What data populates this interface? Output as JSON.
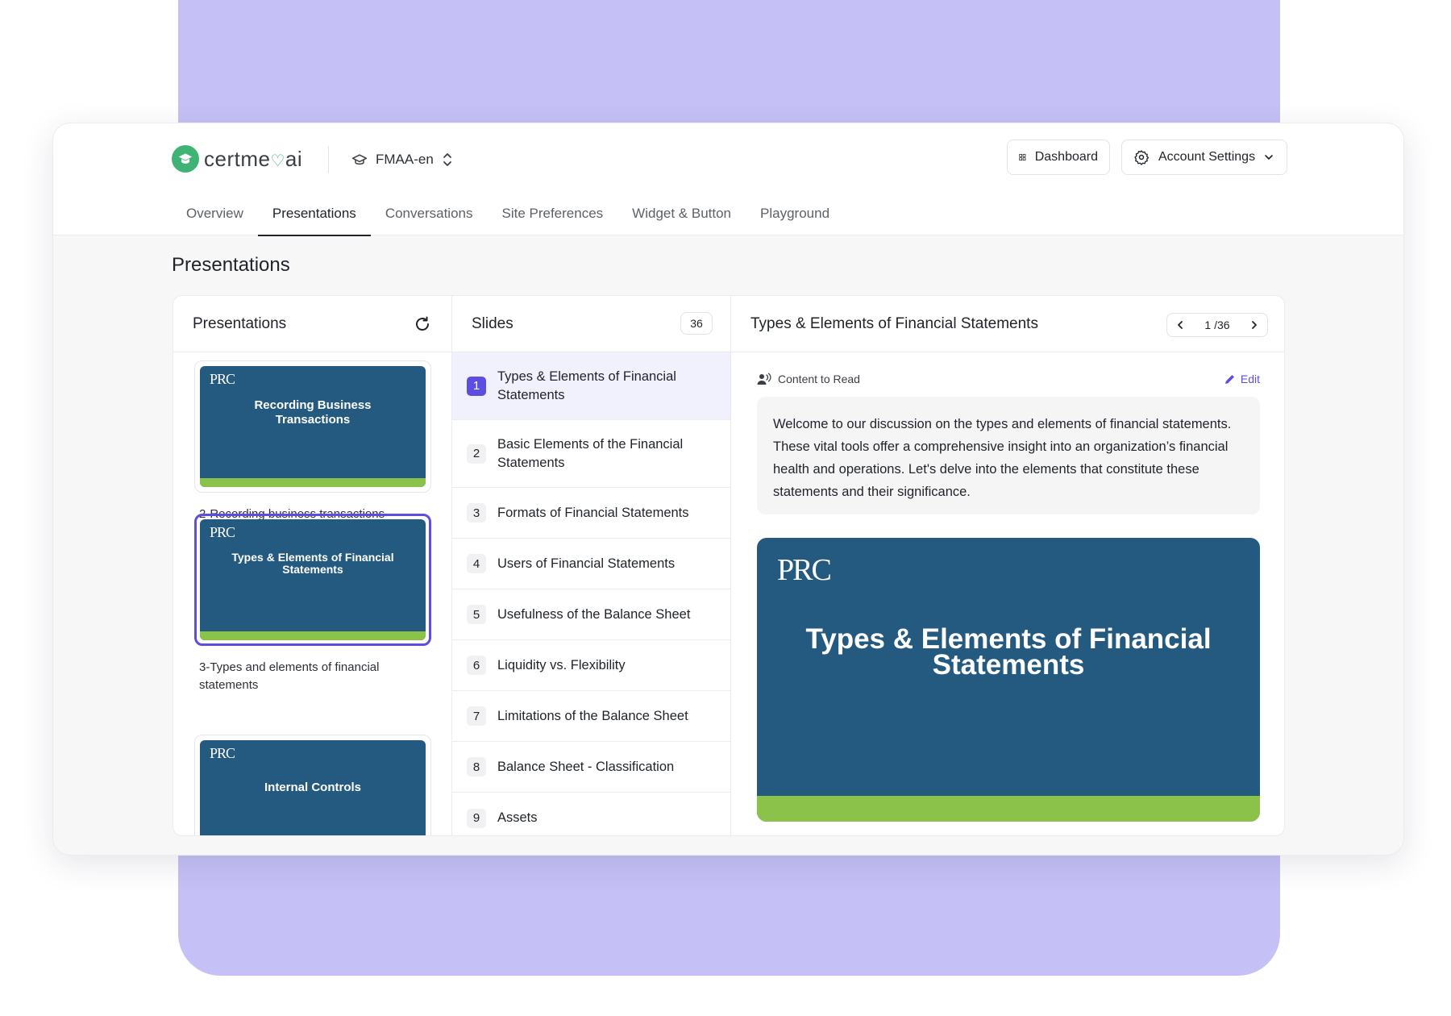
{
  "brand": {
    "name_left": "certme",
    "heart": "♡",
    "name_right": "ai",
    "accent": "#3fb373"
  },
  "workspace": {
    "label": "FMAA-en"
  },
  "header_buttons": {
    "dashboard": "Dashboard",
    "account": "Account Settings"
  },
  "tabs": [
    {
      "label": "Overview"
    },
    {
      "label": "Presentations"
    },
    {
      "label": "Conversations"
    },
    {
      "label": "Site Preferences"
    },
    {
      "label": "Widget & Button"
    },
    {
      "label": "Playground"
    }
  ],
  "active_tab": "Presentations",
  "page_title": "Presentations",
  "presentations_panel": {
    "title": "Presentations",
    "items": [
      {
        "logo": "PRC",
        "thumb_title": "Recording Business Transactions",
        "label": "2-Recording business transactions",
        "selected": false
      },
      {
        "logo": "PRC",
        "thumb_title": "Types & Elements of Financial Statements",
        "label": "3-Types and elements of financial statements",
        "selected": true
      },
      {
        "logo": "PRC",
        "thumb_title": "Internal Controls",
        "label": "",
        "selected": false
      }
    ]
  },
  "slides_panel": {
    "title": "Slides",
    "count": "36",
    "items": [
      {
        "num": "1",
        "title": "Types & Elements of Financial Statements"
      },
      {
        "num": "2",
        "title": "Basic Elements of the Financial Statements"
      },
      {
        "num": "3",
        "title": "Formats of Financial Statements"
      },
      {
        "num": "4",
        "title": "Users of Financial Statements"
      },
      {
        "num": "5",
        "title": "Usefulness of the Balance Sheet"
      },
      {
        "num": "6",
        "title": "Liquidity vs. Flexibility"
      },
      {
        "num": "7",
        "title": "Limitations of the Balance Sheet"
      },
      {
        "num": "8",
        "title": "Balance Sheet - Classification"
      },
      {
        "num": "9",
        "title": "Assets"
      }
    ]
  },
  "detail": {
    "title": "Types & Elements of Financial Statements",
    "pager": "1 /36",
    "content_label": "Content to Read",
    "edit_label": "Edit",
    "content_text": "Welcome to our discussion on the types and elements of financial statements. These vital tools offer a comprehensive insight into an organization’s financial health and operations. Let's delve into the elements that constitute these statements and their significance.",
    "slide_logo": "PRC",
    "slide_title": "Types & Elements of Financial Statements"
  },
  "colors": {
    "slide_blue": "#255a80",
    "slide_green": "#8bc34a",
    "accent_purple": "#5b4ee0",
    "backdrop": "#c5c1f6"
  }
}
